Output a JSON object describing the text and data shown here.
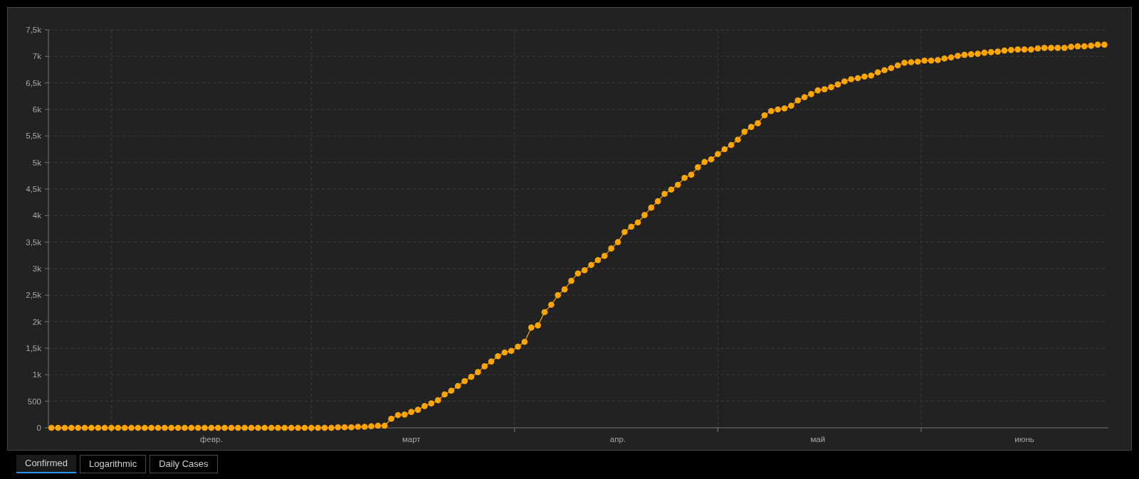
{
  "chart": {
    "chart_data": {
      "type": "line",
      "grid": true,
      "ylim": [
        0,
        7500
      ],
      "categories": [
        null,
        null,
        null,
        null,
        null,
        null,
        null,
        null,
        null,
        null,
        null,
        null,
        null,
        null,
        null,
        null,
        null,
        null,
        null,
        null,
        null,
        null,
        null,
        null,
        "февр.",
        null,
        null,
        null,
        null,
        null,
        null,
        null,
        null,
        null,
        null,
        null,
        null,
        null,
        null,
        null,
        null,
        null,
        null,
        null,
        null,
        null,
        null,
        null,
        null,
        null,
        null,
        null,
        null,
        null,
        "март",
        null,
        null,
        null,
        null,
        null,
        null,
        null,
        null,
        null,
        null,
        null,
        null,
        null,
        null,
        null,
        null,
        null,
        null,
        null,
        null,
        null,
        null,
        null,
        null,
        null,
        null,
        null,
        null,
        null,
        null,
        "апр.",
        null,
        null,
        null,
        null,
        null,
        null,
        null,
        null,
        null,
        null,
        null,
        null,
        null,
        null,
        null,
        null,
        null,
        null,
        null,
        null,
        null,
        null,
        null,
        null,
        null,
        null,
        null,
        null,
        null,
        "май",
        null,
        null,
        null,
        null,
        null,
        null,
        null,
        null,
        null,
        null,
        null,
        null,
        null,
        null,
        null,
        null,
        null,
        null,
        null,
        null,
        null,
        null,
        null,
        null,
        null,
        null,
        null,
        null,
        null,
        null,
        "июнь",
        null,
        null,
        null,
        null,
        null,
        null,
        null,
        null,
        null,
        null,
        null,
        null
      ],
      "yticks": [
        {
          "value": 0,
          "label": "0"
        },
        {
          "value": 500,
          "label": "500"
        },
        {
          "value": 1000,
          "label": "1k"
        },
        {
          "value": 1500,
          "label": "1,5k"
        },
        {
          "value": 2000,
          "label": "2k"
        },
        {
          "value": 2500,
          "label": "2,5k"
        },
        {
          "value": 3000,
          "label": "3k"
        },
        {
          "value": 3500,
          "label": "3,5k"
        },
        {
          "value": 4000,
          "label": "4k"
        },
        {
          "value": 4500,
          "label": "4,5k"
        },
        {
          "value": 5000,
          "label": "5k"
        },
        {
          "value": 5500,
          "label": "5,5k"
        },
        {
          "value": 6000,
          "label": "6k"
        },
        {
          "value": 6500,
          "label": "6,5k"
        },
        {
          "value": 7000,
          "label": "7k"
        },
        {
          "value": 7500,
          "label": "7,5k"
        }
      ],
      "series": [
        {
          "color": "#ffa500",
          "marker": "circle",
          "values": [
            0,
            0,
            0,
            0,
            0,
            0,
            0,
            0,
            0,
            0,
            0,
            0,
            0,
            0,
            0,
            0,
            0,
            0,
            0,
            0,
            0,
            0,
            0,
            0,
            0,
            0,
            0,
            0,
            0,
            0,
            0,
            0,
            0,
            0,
            0,
            0,
            0,
            0,
            0,
            0,
            0,
            0,
            0,
            10,
            10,
            10,
            20,
            20,
            30,
            40,
            40,
            170,
            240,
            250,
            300,
            340,
            410,
            460,
            520,
            630,
            700,
            790,
            880,
            960,
            1050,
            1160,
            1250,
            1350,
            1420,
            1450,
            1530,
            1620,
            1890,
            1930,
            2180,
            2320,
            2500,
            2610,
            2770,
            2910,
            2970,
            3070,
            3160,
            3240,
            3380,
            3500,
            3690,
            3790,
            3870,
            4010,
            4150,
            4270,
            4410,
            4490,
            4580,
            4710,
            4770,
            4910,
            5010,
            5060,
            5160,
            5250,
            5330,
            5430,
            5580,
            5670,
            5740,
            5890,
            5970,
            6000,
            6020,
            6070,
            6170,
            6230,
            6290,
            6360,
            6380,
            6420,
            6470,
            6530,
            6570,
            6590,
            6620,
            6640,
            6700,
            6740,
            6780,
            6830,
            6880,
            6890,
            6900,
            6920,
            6920,
            6930,
            6960,
            6980,
            7010,
            7030,
            7040,
            7050,
            7070,
            7080,
            7090,
            7110,
            7120,
            7130,
            7130,
            7130,
            7150,
            7160,
            7160,
            7160,
            7160,
            7180,
            7190,
            7190,
            7200,
            7220,
            7220
          ]
        }
      ]
    }
  },
  "tabs": [
    {
      "label": "Confirmed",
      "selected": true
    },
    {
      "label": "Logarithmic",
      "selected": false
    },
    {
      "label": "Daily Cases",
      "selected": false
    }
  ]
}
